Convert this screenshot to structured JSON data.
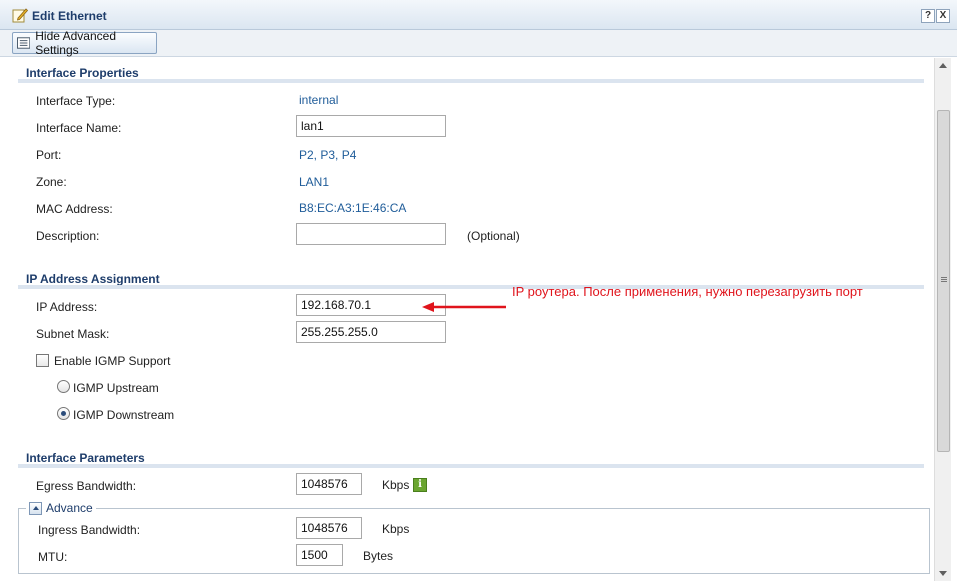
{
  "window": {
    "title": "Edit Ethernet",
    "help_label": "?",
    "close_label": "X"
  },
  "toolbar": {
    "toggle_label": "Hide Advanced Settings"
  },
  "interface_properties": {
    "header": "Interface Properties",
    "type_label": "Interface Type:",
    "type_value": "internal",
    "name_label": "Interface Name:",
    "name_value": "lan1",
    "port_label": "Port:",
    "port_value": "P2, P3, P4",
    "zone_label": "Zone:",
    "zone_value": "LAN1",
    "mac_label": "MAC Address:",
    "mac_value": "B8:EC:A3:1E:46:CA",
    "description_label": "Description:",
    "description_value": "",
    "optional_hint": "(Optional)"
  },
  "ip_assignment": {
    "header": "IP Address Assignment",
    "ip_label": "IP Address:",
    "ip_value": "192.168.70.1",
    "mask_label": "Subnet Mask:",
    "mask_value": "255.255.255.0",
    "igmp_label": "Enable IGMP Support",
    "igmp_checked": false,
    "upstream_label": "IGMP Upstream",
    "downstream_label": "IGMP Downstream",
    "selected_mode": "IGMP Downstream"
  },
  "annotation": {
    "text": "IP роутера. После применения, нужно перезагрузить порт",
    "color": "#e0141c"
  },
  "interface_parameters": {
    "header": "Interface Parameters",
    "egress_label": "Egress Bandwidth:",
    "egress_value": "1048576",
    "egress_unit": "Kbps",
    "info_label": "i",
    "advance_label": "Advance",
    "ingress_label": "Ingress Bandwidth:",
    "ingress_value": "1048576",
    "ingress_unit": "Kbps",
    "mtu_label": "MTU:",
    "mtu_value": "1500",
    "mtu_unit": "Bytes"
  },
  "colors": {
    "header_text": "#1e3d6b",
    "value_text": "#1f5c99",
    "rule": "#dbe4ef"
  }
}
